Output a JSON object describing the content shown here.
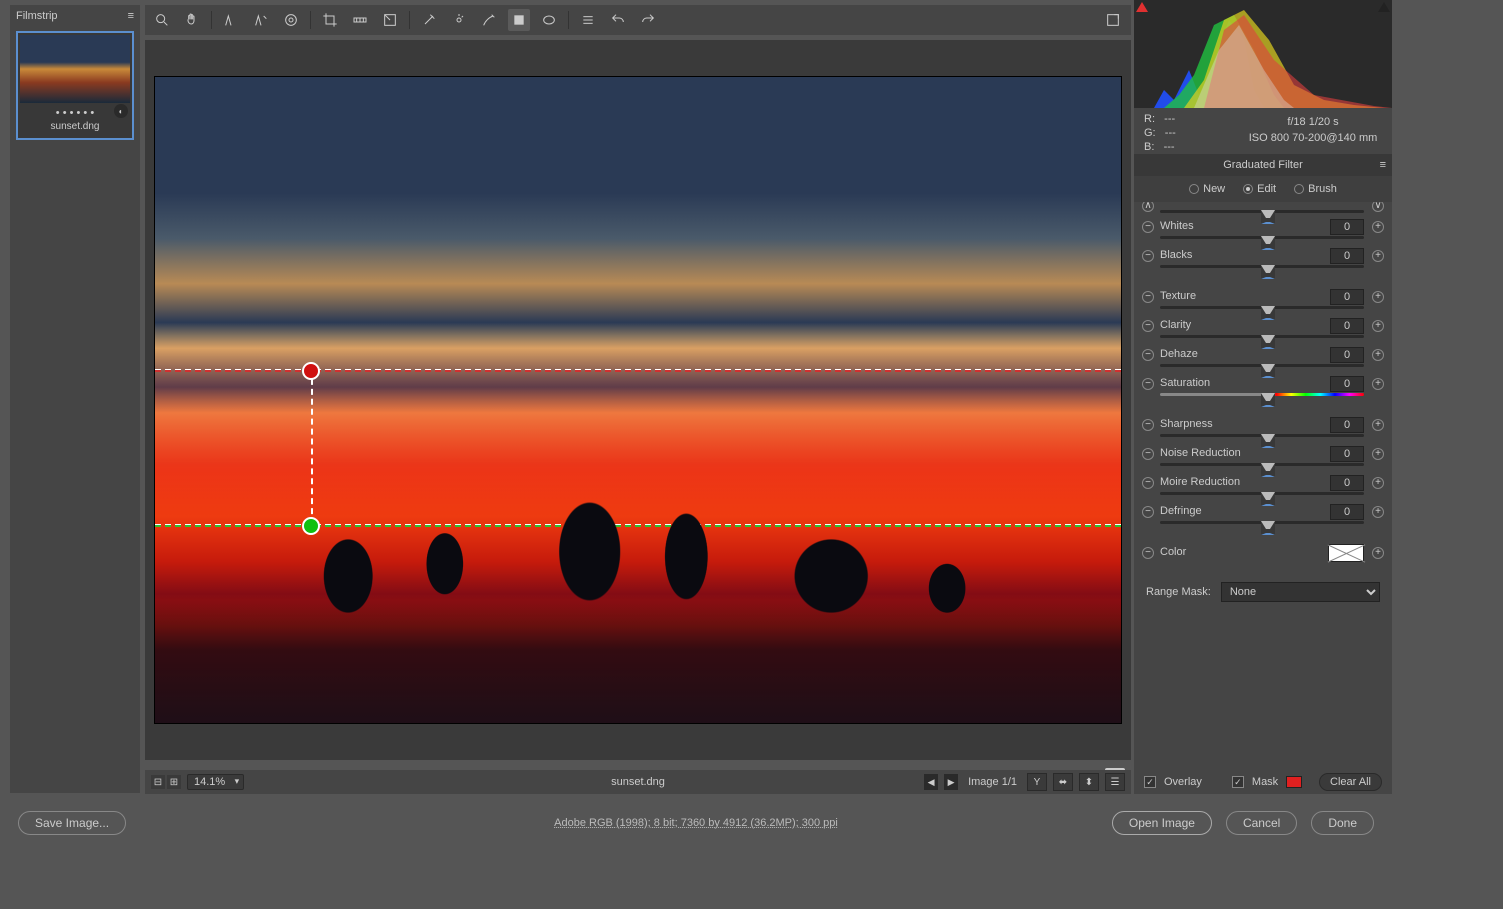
{
  "filmstrip": {
    "title": "Filmstrip",
    "thumbs": [
      {
        "name": "sunset.dng",
        "dots": "• • • • • •"
      }
    ]
  },
  "canvas": {
    "filename": "sunset.dng",
    "zoom": "14.1%",
    "image_count": "Image 1/1"
  },
  "histogram": {
    "rgb_labels": {
      "r": "R:",
      "g": "G:",
      "b": "B:"
    },
    "rgb_values": {
      "r": "---",
      "g": "---",
      "b": "---"
    },
    "exif1": "f/18    1/20 s",
    "exif2": "ISO 800    70-200@140 mm"
  },
  "panel": {
    "title": "Graduated Filter",
    "modes": {
      "new": "New",
      "edit": "Edit",
      "brush": "Brush",
      "selected": "edit"
    },
    "sliders": {
      "whites": {
        "label": "Whites",
        "value": "0"
      },
      "blacks": {
        "label": "Blacks",
        "value": "0"
      },
      "texture": {
        "label": "Texture",
        "value": "0"
      },
      "clarity": {
        "label": "Clarity",
        "value": "0"
      },
      "dehaze": {
        "label": "Dehaze",
        "value": "0"
      },
      "saturation": {
        "label": "Saturation",
        "value": "0"
      },
      "sharpness": {
        "label": "Sharpness",
        "value": "0"
      },
      "noise": {
        "label": "Noise Reduction",
        "value": "0"
      },
      "moire": {
        "label": "Moire Reduction",
        "value": "0"
      },
      "defringe": {
        "label": "Defringe",
        "value": "0"
      },
      "color": {
        "label": "Color"
      }
    },
    "rangemask": {
      "label": "Range Mask:",
      "value": "None"
    },
    "overlay": {
      "overlay_label": "Overlay",
      "mask_label": "Mask",
      "clear": "Clear All"
    }
  },
  "footer": {
    "save": "Save Image...",
    "meta": "Adobe RGB (1998); 8 bit; 7360 by 4912 (36.2MP); 300 ppi",
    "open": "Open Image",
    "cancel": "Cancel",
    "done": "Done"
  }
}
